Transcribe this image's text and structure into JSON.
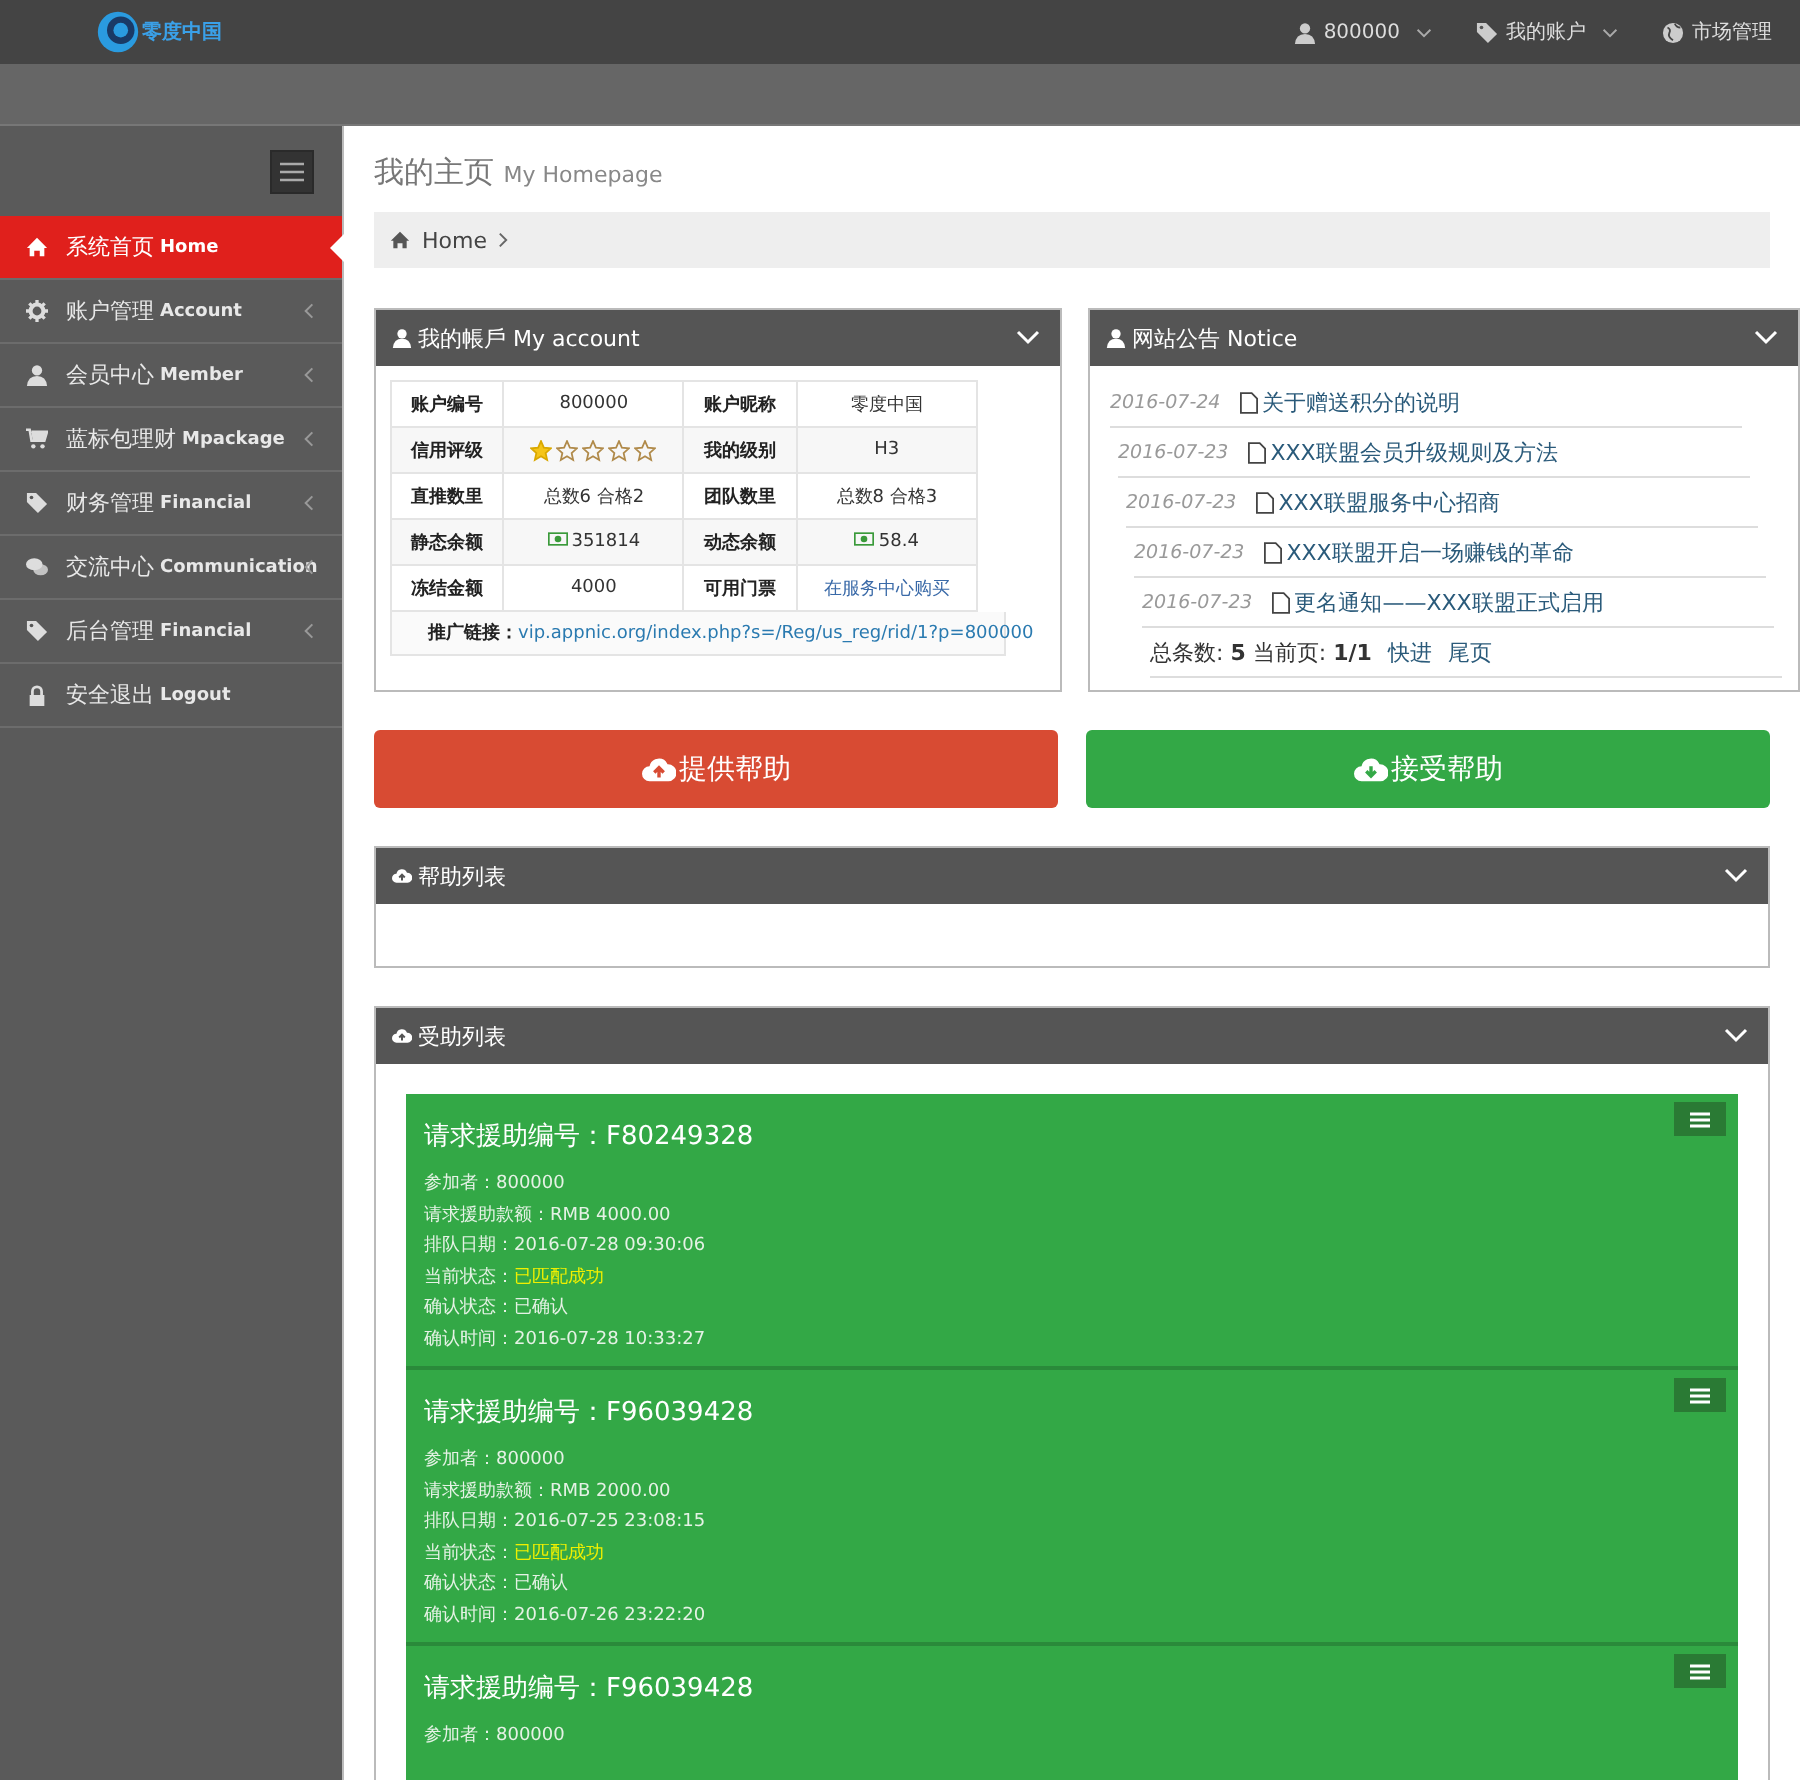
{
  "topbar": {
    "logo": "零度中国",
    "nav": [
      {
        "kind": "user",
        "label": "800000",
        "dropdown": true
      },
      {
        "kind": "tag",
        "label": "我的账户",
        "dropdown": true
      },
      {
        "kind": "globe",
        "label": "市场管理",
        "dropdown": false
      }
    ]
  },
  "sidebar": {
    "items": [
      {
        "kind": "home",
        "zh": "系统首页",
        "en": "Home",
        "selected": true,
        "submenu": false
      },
      {
        "kind": "gear",
        "zh": "账户管理",
        "en": "Account",
        "selected": false,
        "submenu": true
      },
      {
        "kind": "user",
        "zh": "会员中心",
        "en": "Member",
        "selected": false,
        "submenu": true
      },
      {
        "kind": "cart",
        "zh": "蓝标包理财",
        "en": "Mpackage",
        "selected": false,
        "submenu": true
      },
      {
        "kind": "tag",
        "zh": "财务管理",
        "en": "Financial",
        "selected": false,
        "submenu": true
      },
      {
        "kind": "chat",
        "zh": "交流中心",
        "en": "Communication",
        "selected": false,
        "submenu": true
      },
      {
        "kind": "tag",
        "zh": "后台管理",
        "en": "Financial",
        "selected": false,
        "submenu": true
      },
      {
        "kind": "lock",
        "zh": "安全退出",
        "en": "Logout",
        "selected": false,
        "submenu": false
      }
    ]
  },
  "page": {
    "title": "我的主页",
    "subtitle": "My Homepage",
    "breadcrumb": "Home"
  },
  "account": {
    "title": "我的帳戶 My account",
    "rows": [
      [
        {
          "label": "账户编号",
          "kind": "text",
          "value": "800000"
        },
        {
          "label": "账户昵称",
          "kind": "text",
          "value": "零度中国"
        }
      ],
      [
        {
          "label": "信用评级",
          "kind": "stars",
          "stars": 1
        },
        {
          "label": "我的级别",
          "kind": "text",
          "value": "H3"
        }
      ],
      [
        {
          "label": "直推数里",
          "kind": "text",
          "value": "总数6 合格2"
        },
        {
          "label": "团队数里",
          "kind": "text",
          "value": "总数8 合格3"
        }
      ],
      [
        {
          "label": "静态余额",
          "kind": "money",
          "value": "351814"
        },
        {
          "label": "动态余额",
          "kind": "money",
          "value": "58.4"
        }
      ],
      [
        {
          "label": "冻结金额",
          "kind": "text",
          "value": "4000"
        },
        {
          "label": "可用门票",
          "kind": "link",
          "value": "在服务中心购买"
        }
      ]
    ],
    "referral_label": "推广链接：",
    "referral_url": "vip.appnic.org/index.php?s=/Reg/us_reg/rid/1?p=800000"
  },
  "notice": {
    "title": "网站公告 Notice",
    "items": [
      {
        "date": "2016-07-24",
        "title": "关于赠送积分的说明"
      },
      {
        "date": "2016-07-23",
        "title": "XXX联盟会员升级规则及方法"
      },
      {
        "date": "2016-07-23",
        "title": "XXX联盟服务中心招商"
      },
      {
        "date": "2016-07-23",
        "title": "XXX联盟开启一场赚钱的革命"
      },
      {
        "date": "2016-07-23",
        "title": "更名通知——XXX联盟正式启用"
      }
    ],
    "pagination": "总条数: **5** 当前页: **1/1**",
    "links": [
      "快进",
      "尾页"
    ]
  },
  "actions": [
    {
      "kind": "provide",
      "label": "提供帮助"
    },
    {
      "kind": "receive",
      "label": "接受帮助"
    }
  ],
  "help_list": {
    "title": "帮助列表"
  },
  "receive_list": {
    "title": "受助列表",
    "cards": [
      {
        "title": "请求援助编号：F80249328",
        "fields": [
          {
            "label": "参加者：",
            "value": "800000",
            "highlight": false
          },
          {
            "label": "请求援助款额：",
            "value": "RMB 4000.00",
            "highlight": false
          },
          {
            "label": "排队日期：",
            "value": "2016-07-28 09:30:06",
            "highlight": false
          },
          {
            "label": "当前状态：",
            "value": "已匹配成功",
            "highlight": true
          },
          {
            "label": "确认状态：",
            "value": "已确认",
            "highlight": false
          },
          {
            "label": "确认时间：",
            "value": "2016-07-28 10:33:27",
            "highlight": false
          }
        ]
      },
      {
        "title": "请求援助编号：F96039428",
        "fields": [
          {
            "label": "参加者：",
            "value": "800000",
            "highlight": false
          },
          {
            "label": "请求援助款额：",
            "value": "RMB 2000.00",
            "highlight": false
          },
          {
            "label": "排队日期：",
            "value": "2016-07-25 23:08:15",
            "highlight": false
          },
          {
            "label": "当前状态：",
            "value": "已匹配成功",
            "highlight": true
          },
          {
            "label": "确认状态：",
            "value": "已确认",
            "highlight": false
          },
          {
            "label": "确认时间：",
            "value": "2016-07-26 23:22:20",
            "highlight": false
          }
        ]
      },
      {
        "title": "请求援助编号：F96039428",
        "fields": [
          {
            "label": "参加者：",
            "value": "800000",
            "highlight": false
          }
        ]
      }
    ]
  }
}
